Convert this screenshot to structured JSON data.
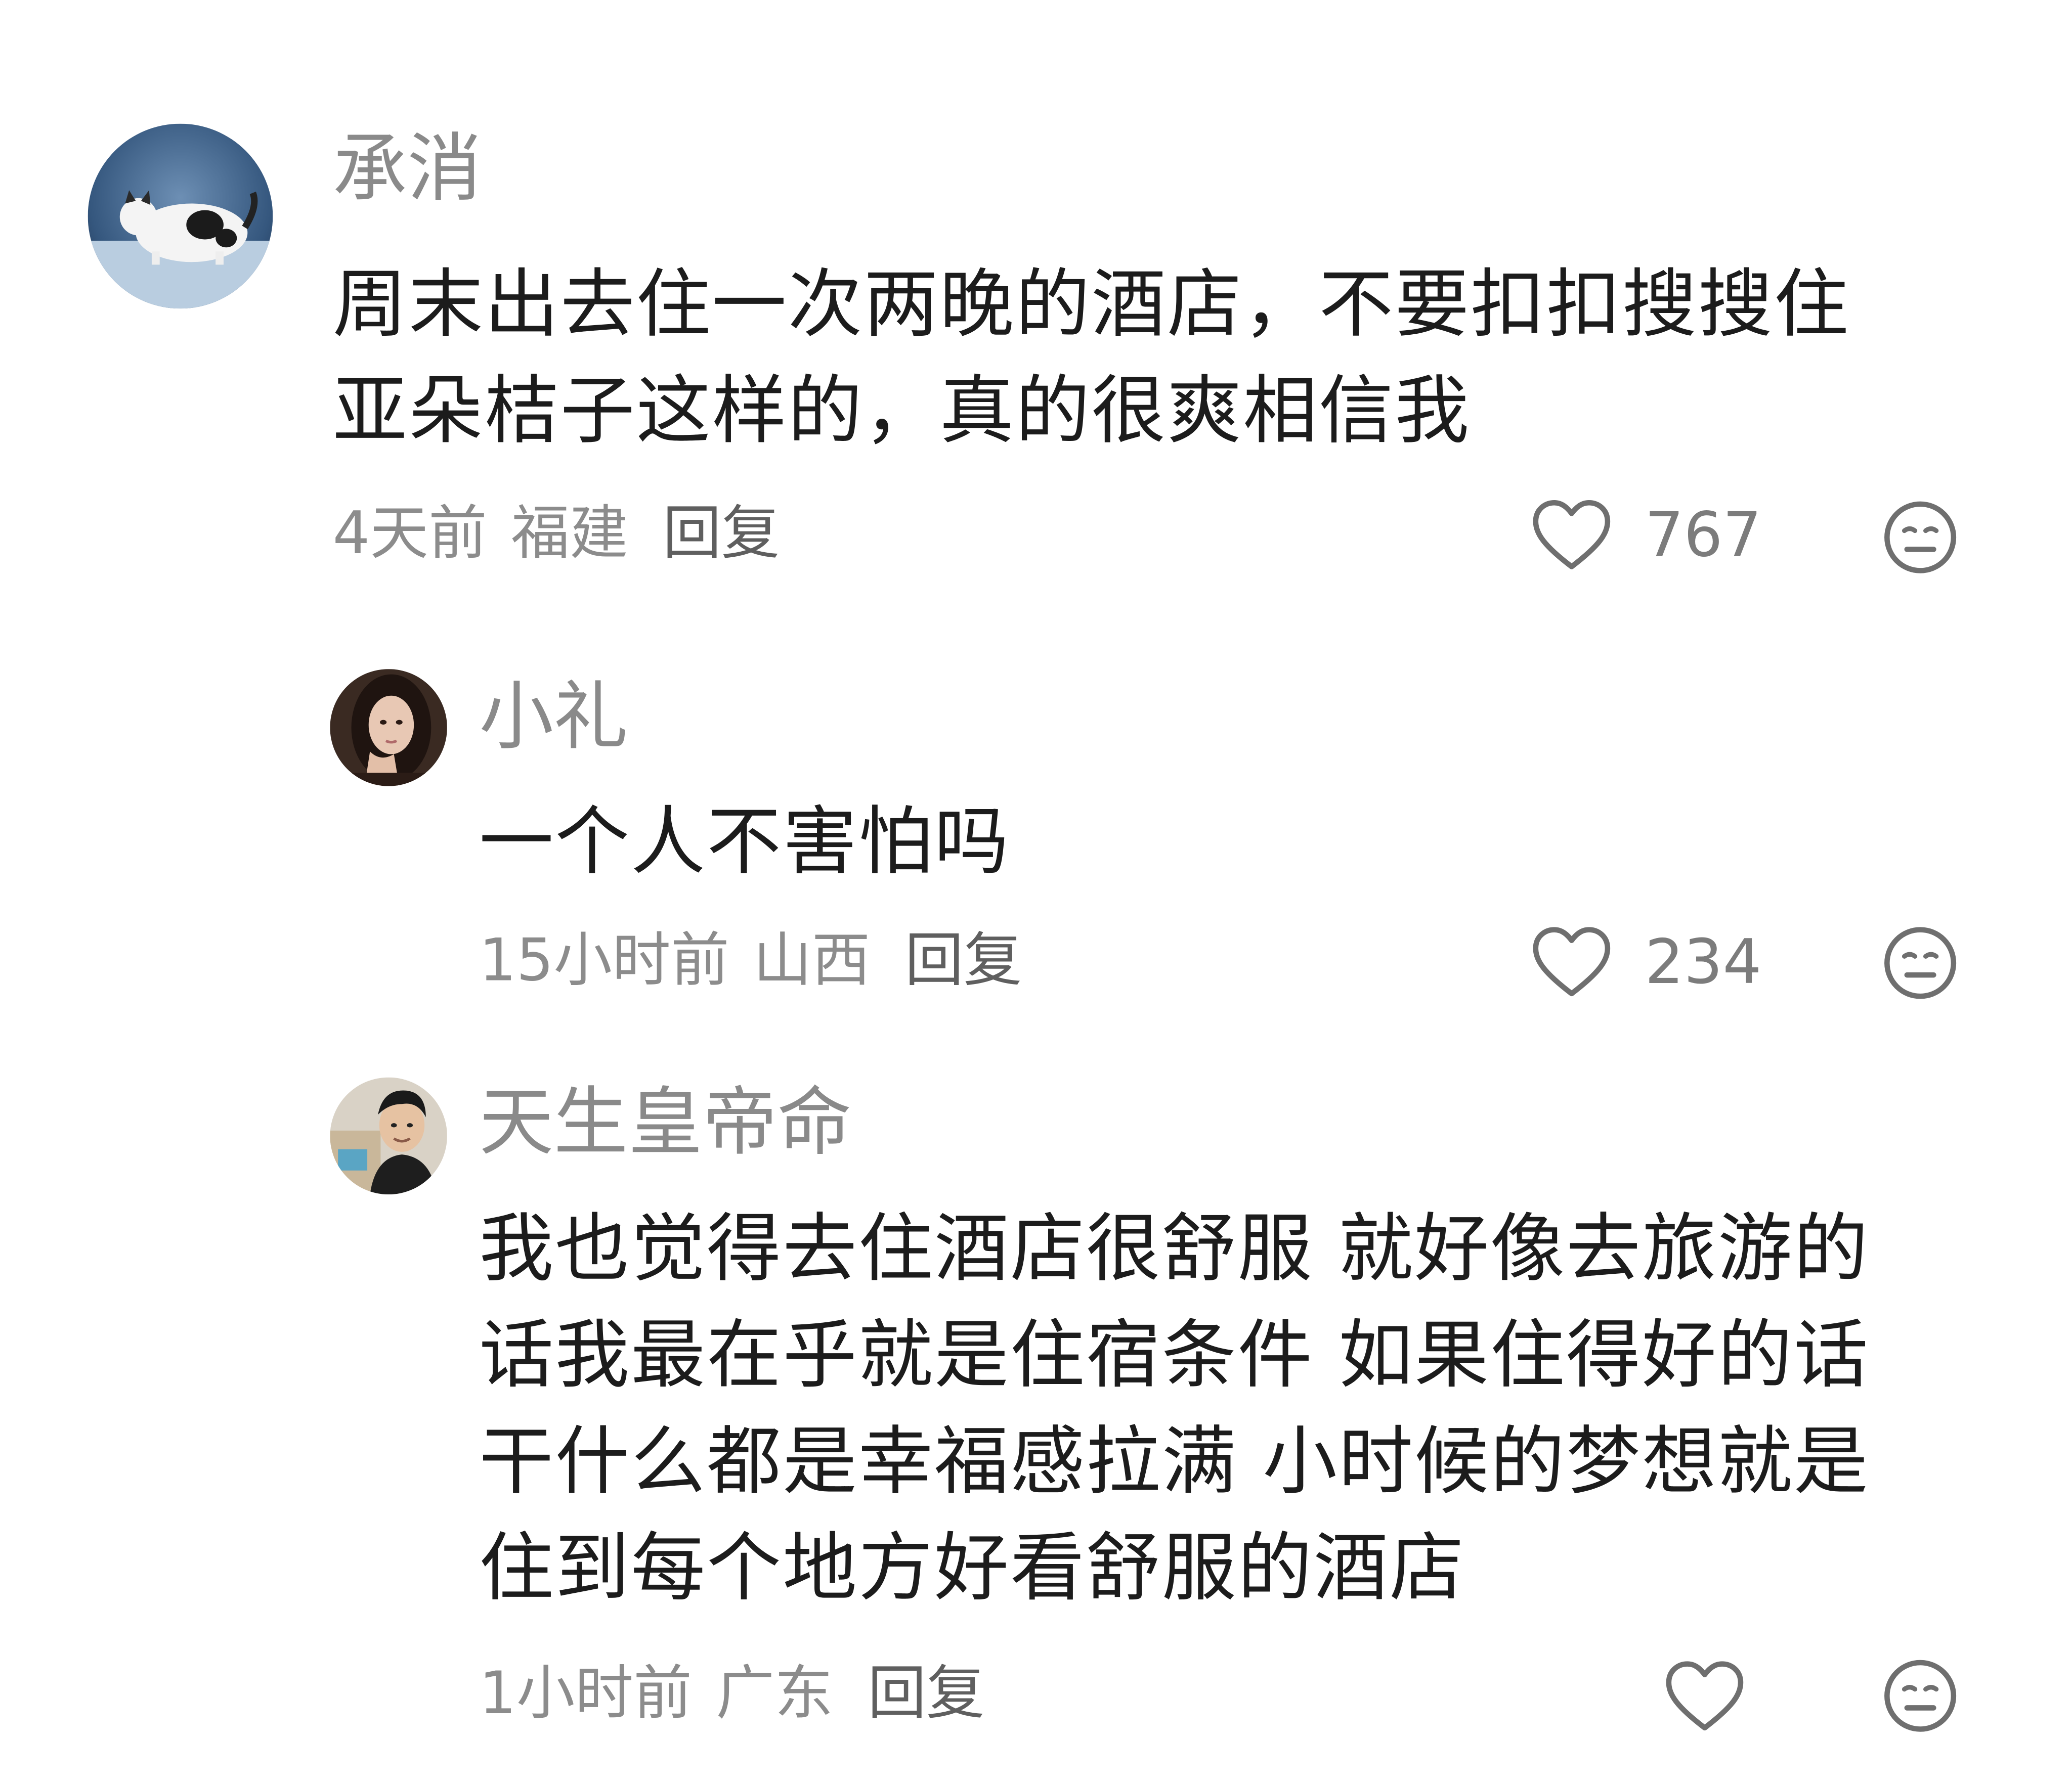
{
  "comments": [
    {
      "username": "承消",
      "content_lines": [
        "周末出去住一次两晚的酒店，不要扣扣搜搜住",
        "亚朵桔子这样的，真的很爽相信我"
      ],
      "time": "4天前",
      "location": "福建",
      "reply_label": "回复",
      "like_count": "767",
      "avatar_icon": "cat-photo-avatar"
    },
    {
      "username": "小礼",
      "content_lines": [
        "一个人不害怕吗"
      ],
      "time": "15小时前",
      "location": "山西",
      "reply_label": "回复",
      "like_count": "234",
      "avatar_icon": "woman-photo-avatar"
    },
    {
      "username": "天生皇帝命",
      "content_lines": [
        "我也觉得去住酒店很舒服 就好像去旅游的",
        "话我最在乎就是住宿条件 如果住得好的话",
        "干什么都是幸福感拉满 小时候的梦想就是",
        "住到每个地方好看舒服的酒店"
      ],
      "time": "1小时前",
      "location": "广东",
      "reply_label": "回复",
      "like_count": "",
      "avatar_icon": "man-photo-avatar"
    }
  ],
  "icons": {
    "like": "heart-outline-icon",
    "dislike": "meh-face-icon"
  },
  "colors": {
    "username": "#8a8a8a",
    "content": "#1c1c1c",
    "meta": "#8c8c8c",
    "icon": "#6f6f6f"
  }
}
